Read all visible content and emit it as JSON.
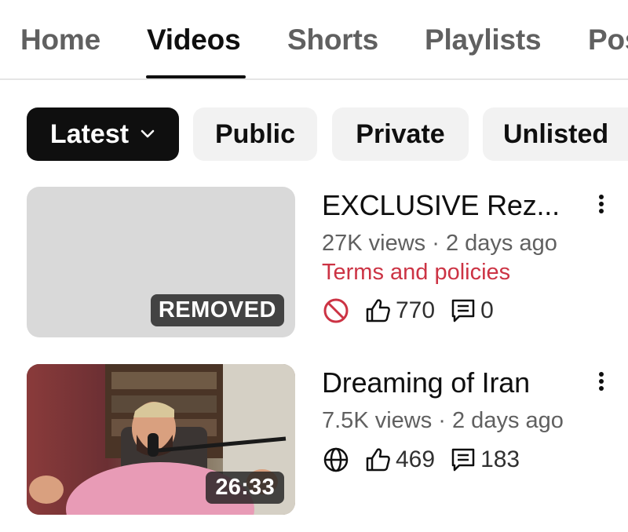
{
  "tabs": [
    {
      "label": "Home",
      "active": false
    },
    {
      "label": "Videos",
      "active": true
    },
    {
      "label": "Shorts",
      "active": false
    },
    {
      "label": "Playlists",
      "active": false
    },
    {
      "label": "Pos",
      "active": false
    }
  ],
  "filters": [
    {
      "label": "Latest",
      "selected": true,
      "icon": "chevron-down-icon"
    },
    {
      "label": "Public",
      "selected": false
    },
    {
      "label": "Private",
      "selected": false
    },
    {
      "label": "Unlisted",
      "selected": false
    }
  ],
  "videos": [
    {
      "title": "EXCLUSIVE Rez...",
      "meta": "27K views · 2 days ago",
      "policy": "Terms and policies",
      "badge": "REMOVED",
      "visibility_icon": "blocked-icon",
      "likes": "770",
      "comments": "0"
    },
    {
      "title": "Dreaming of Iran",
      "meta": "7.5K views · 2 days ago",
      "duration": "26:33",
      "visibility_icon": "globe-icon",
      "likes": "469",
      "comments": "183"
    }
  ],
  "colors": {
    "accent_red": "#cc3344",
    "text_primary": "#0f0f0f",
    "text_secondary": "#606060",
    "chip_bg": "#f2f2f2"
  }
}
